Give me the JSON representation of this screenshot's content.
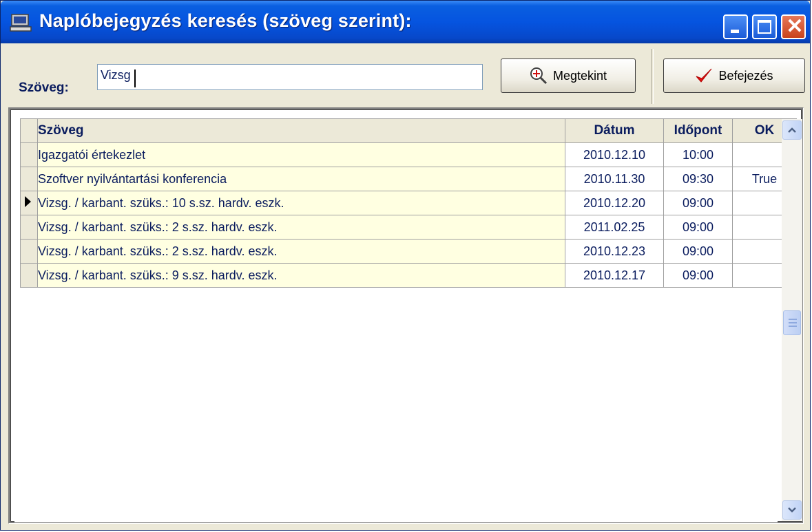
{
  "window": {
    "title": "Naplóbejegyzés keresés (szöveg szerint):",
    "close_glyph": "✕"
  },
  "search": {
    "label": "Szöveg:",
    "value": "Vizsg"
  },
  "toolbar": {
    "view_label": "Megtekint",
    "finish_label": "Befejezés"
  },
  "grid": {
    "columns": [
      "Szöveg",
      "Dátum",
      "Időpont",
      "OK"
    ],
    "current_row_index": 2,
    "rows": [
      {
        "text": "Igazgatói értekezlet",
        "date": "2010.12.10",
        "time": "10:00",
        "ok": ""
      },
      {
        "text": "Szoftver nyilvántartási konferencia",
        "date": "2010.11.30",
        "time": "09:30",
        "ok": "True"
      },
      {
        "text": "Vizsg. / karbant. szüks.: 10 s.sz. hardv. eszk.",
        "date": "2010.12.20",
        "time": "09:00",
        "ok": ""
      },
      {
        "text": "Vizsg. / karbant. szüks.: 2 s.sz. hardv. eszk.",
        "date": "2011.02.25",
        "time": "09:00",
        "ok": ""
      },
      {
        "text": "Vizsg. / karbant. szüks.: 2 s.sz. hardv. eszk.",
        "date": "2010.12.23",
        "time": "09:00",
        "ok": ""
      },
      {
        "text": "Vizsg. / karbant. szüks.: 9 s.sz. hardv. eszk.",
        "date": "2010.12.17",
        "time": "09:00",
        "ok": ""
      }
    ]
  },
  "icons": {
    "window_icon": "computer-icon",
    "view_icon": "zoom-in-icon",
    "finish_icon": "checkmark-icon",
    "checkmark_color": "#e01010",
    "titlebar_color": "#0554e0"
  }
}
